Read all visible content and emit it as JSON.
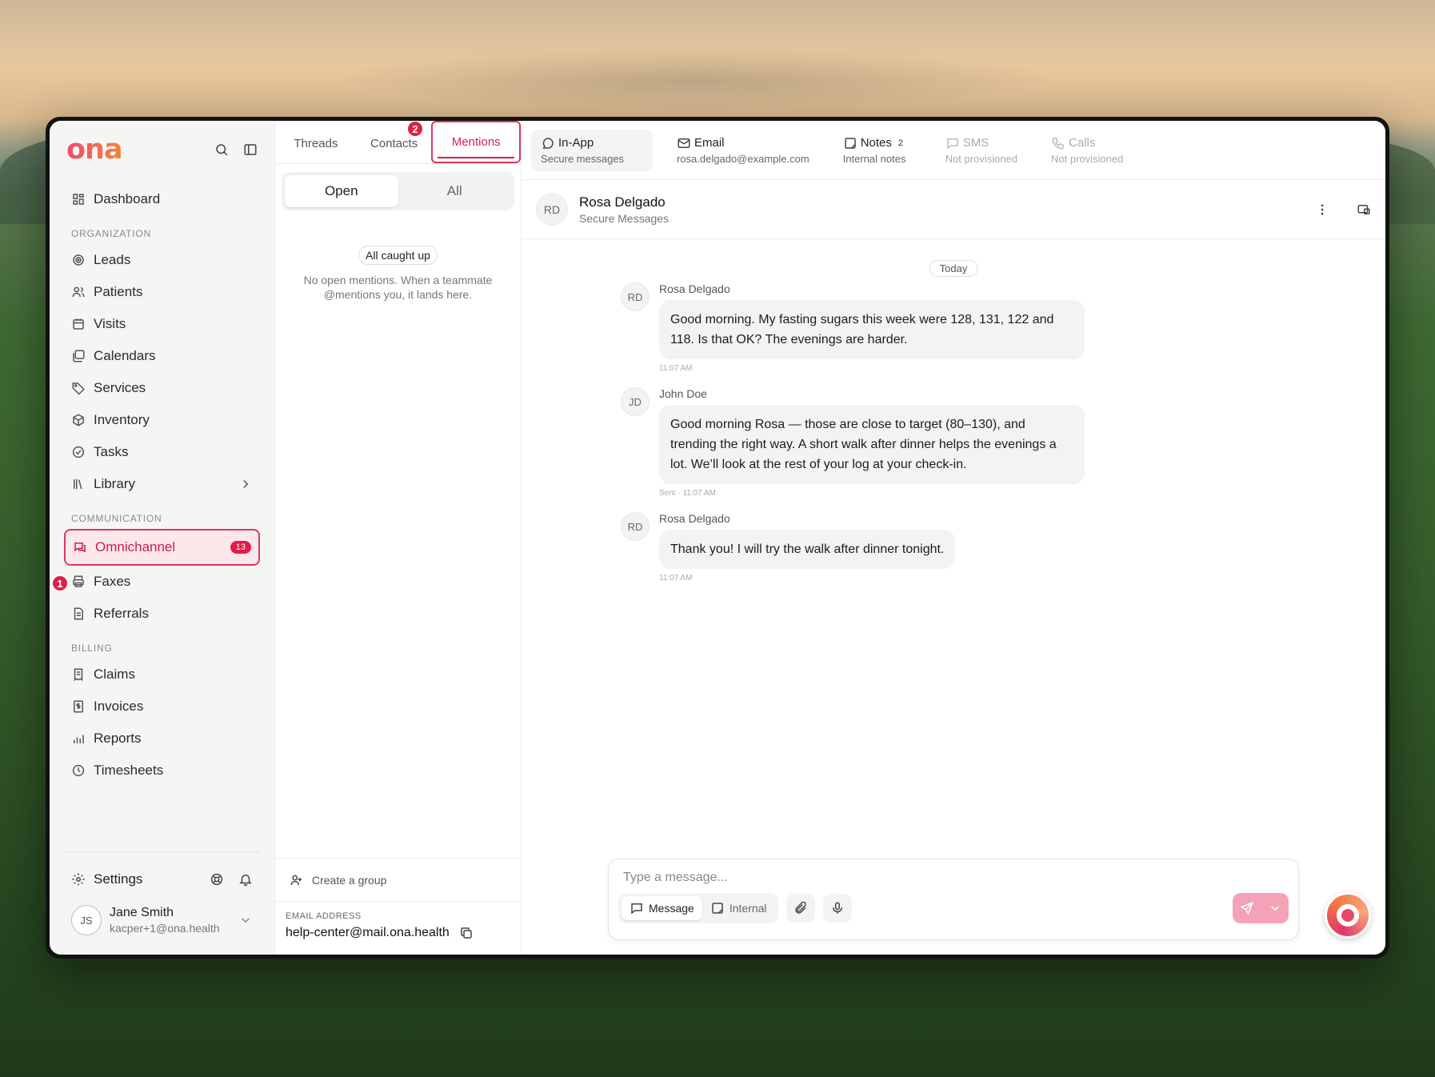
{
  "app": {
    "logo": "ona"
  },
  "sidebar": {
    "dashboard": "Dashboard",
    "sections": {
      "organization": "ORGANIZATION",
      "communication": "COMMUNICATION",
      "billing": "BILLING"
    },
    "org_items": [
      {
        "label": "Leads",
        "icon": "target-icon"
      },
      {
        "label": "Patients",
        "icon": "users-icon"
      },
      {
        "label": "Visits",
        "icon": "calendar-grid-icon"
      },
      {
        "label": "Calendars",
        "icon": "calendars-icon"
      },
      {
        "label": "Services",
        "icon": "tag-icon"
      },
      {
        "label": "Inventory",
        "icon": "box-icon"
      },
      {
        "label": "Tasks",
        "icon": "check-circle-icon"
      },
      {
        "label": "Library",
        "icon": "library-icon"
      }
    ],
    "comm_items": [
      {
        "label": "Omnichannel",
        "icon": "chat-icon",
        "badge": "13"
      },
      {
        "label": "Faxes",
        "icon": "printer-icon"
      },
      {
        "label": "Referrals",
        "icon": "document-icon"
      }
    ],
    "billing_items": [
      {
        "label": "Claims",
        "icon": "receipt-icon"
      },
      {
        "label": "Invoices",
        "icon": "invoice-icon"
      },
      {
        "label": "Reports",
        "icon": "chart-icon"
      },
      {
        "label": "Timesheets",
        "icon": "clock-icon"
      }
    ],
    "settings": "Settings",
    "user": {
      "initials": "JS",
      "name": "Jane Smith",
      "email": "kacper+1@ona.health"
    },
    "markers": {
      "one": "1",
      "two": "2"
    }
  },
  "middle": {
    "tabs": {
      "threads": "Threads",
      "contacts": "Contacts",
      "mentions": "Mentions"
    },
    "segment": {
      "open": "Open",
      "all": "All"
    },
    "empty": {
      "pill": "All caught up",
      "text": "No open mentions. When a teammate @mentions you, it lands here."
    },
    "create_group": "Create a group",
    "email": {
      "label": "EMAIL ADDRESS",
      "value": "help-center@mail.ona.health"
    }
  },
  "channels": [
    {
      "key": "inapp",
      "label": "In-App",
      "sub": "Secure messages"
    },
    {
      "key": "email",
      "label": "Email",
      "sub": "rosa.delgado@example.com"
    },
    {
      "key": "notes",
      "label": "Notes",
      "sub": "Internal notes",
      "count": "2"
    },
    {
      "key": "sms",
      "label": "SMS",
      "sub": "Not provisioned"
    },
    {
      "key": "calls",
      "label": "Calls",
      "sub": "Not provisioned"
    }
  ],
  "conversation": {
    "initials": "RD",
    "name": "Rosa Delgado",
    "subtitle": "Secure Messages",
    "day": "Today",
    "messages": [
      {
        "initials": "RD",
        "author": "Rosa Delgado",
        "text": "Good morning. My fasting sugars this week were 128, 131, 122 and 118. Is that OK? The evenings are harder.",
        "time": "11:07 AM"
      },
      {
        "initials": "JD",
        "author": "John Doe",
        "text": "Good morning Rosa — those are close to target (80–130), and trending the right way. A short walk after dinner helps the evenings a lot. We’ll look at the rest of your log at your check-in.",
        "time": "Sent · 11:07 AM"
      },
      {
        "initials": "RD",
        "author": "Rosa Delgado",
        "text": "Thank you! I will try the walk after dinner tonight.",
        "time": "11:07 AM"
      }
    ]
  },
  "composer": {
    "placeholder": "Type a message...",
    "message": "Message",
    "internal": "Internal"
  },
  "colors": {
    "accent": "#e11d48",
    "brand_start": "#ef4b6c",
    "brand_end": "#f2853a"
  }
}
